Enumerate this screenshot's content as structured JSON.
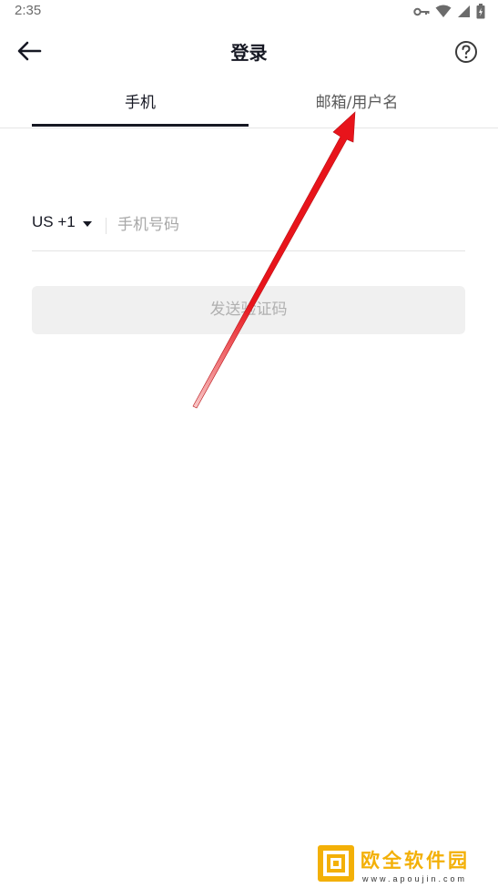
{
  "status_bar": {
    "time": "2:35",
    "icons": [
      "key-icon",
      "wifi-icon",
      "signal-icon",
      "battery-icon"
    ]
  },
  "header": {
    "title": "登录",
    "back_icon": "arrow-left-icon",
    "help_icon": "question-circle-icon"
  },
  "tabs": [
    {
      "label": "手机",
      "selected": true
    },
    {
      "label": "邮箱/用户名",
      "selected": false
    }
  ],
  "phone_form": {
    "country_code": "US +1",
    "dropdown_icon": "caret-down-icon",
    "phone_placeholder": "手机号码",
    "phone_value": "",
    "send_button_label": "发送验证码",
    "send_button_enabled": false
  },
  "annotation": {
    "arrow_color": "#e8141b"
  },
  "watermark": {
    "text": "欧全软件园",
    "url": "www.apoujin.com",
    "color": "#f3b007"
  },
  "colors": {
    "primary_text": "#161823",
    "placeholder": "#a8a8a8",
    "disabled_button_bg": "#f0f0f0",
    "disabled_button_text": "#b0b0b0"
  }
}
